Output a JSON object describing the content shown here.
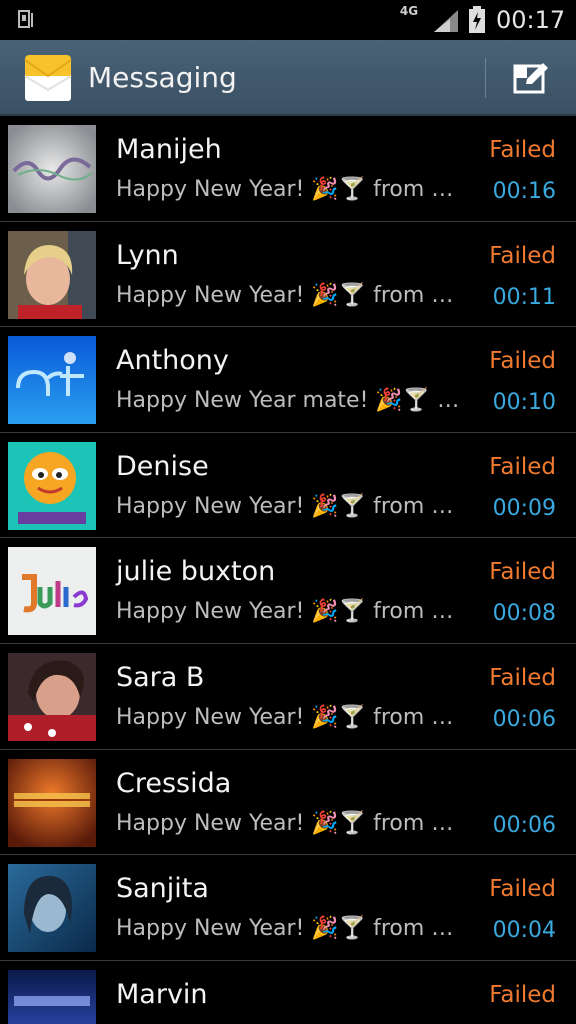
{
  "status_bar": {
    "network": "4G",
    "time": "00:17",
    "icons": [
      "sim-icon",
      "signal-icon",
      "battery-charging-icon"
    ]
  },
  "header": {
    "title": "Messaging",
    "icon": "envelope-icon",
    "compose_icon": "compose-icon"
  },
  "threads": [
    {
      "name": "Manijeh",
      "preview": "Happy New Year! 🎉🍸 from R...",
      "status": "Failed",
      "time": "00:16"
    },
    {
      "name": "Lynn",
      "preview": "Happy New Year! 🎉🍸 from R...",
      "status": "Failed",
      "time": "00:11"
    },
    {
      "name": "Anthony",
      "preview": "Happy New Year mate! 🎉🍸 fr...",
      "status": "Failed",
      "time": "00:10"
    },
    {
      "name": "Denise",
      "preview": "Happy New Year! 🎉🍸 from R...",
      "status": "Failed",
      "time": "00:09"
    },
    {
      "name": "julie buxton",
      "preview": "Happy New Year! 🎉🍸 from R...",
      "status": "Failed",
      "time": "00:08"
    },
    {
      "name": "Sara B",
      "preview": "Happy New Year! 🎉🍸 from R...",
      "status": "Failed",
      "time": "00:06"
    },
    {
      "name": "Cressida",
      "preview": "Happy New Year! 🎉🍸 from R...",
      "status": "",
      "time": "00:06"
    },
    {
      "name": "Sanjita",
      "preview": "Happy New Year! 🎉🍸 from R...",
      "status": "Failed",
      "time": "00:04"
    },
    {
      "name": "Marvin",
      "preview": "",
      "status": "Failed",
      "time": ""
    }
  ],
  "colors": {
    "failed": "#f07a2e",
    "time": "#3aa9e0",
    "action_bar": "#3f566a"
  }
}
